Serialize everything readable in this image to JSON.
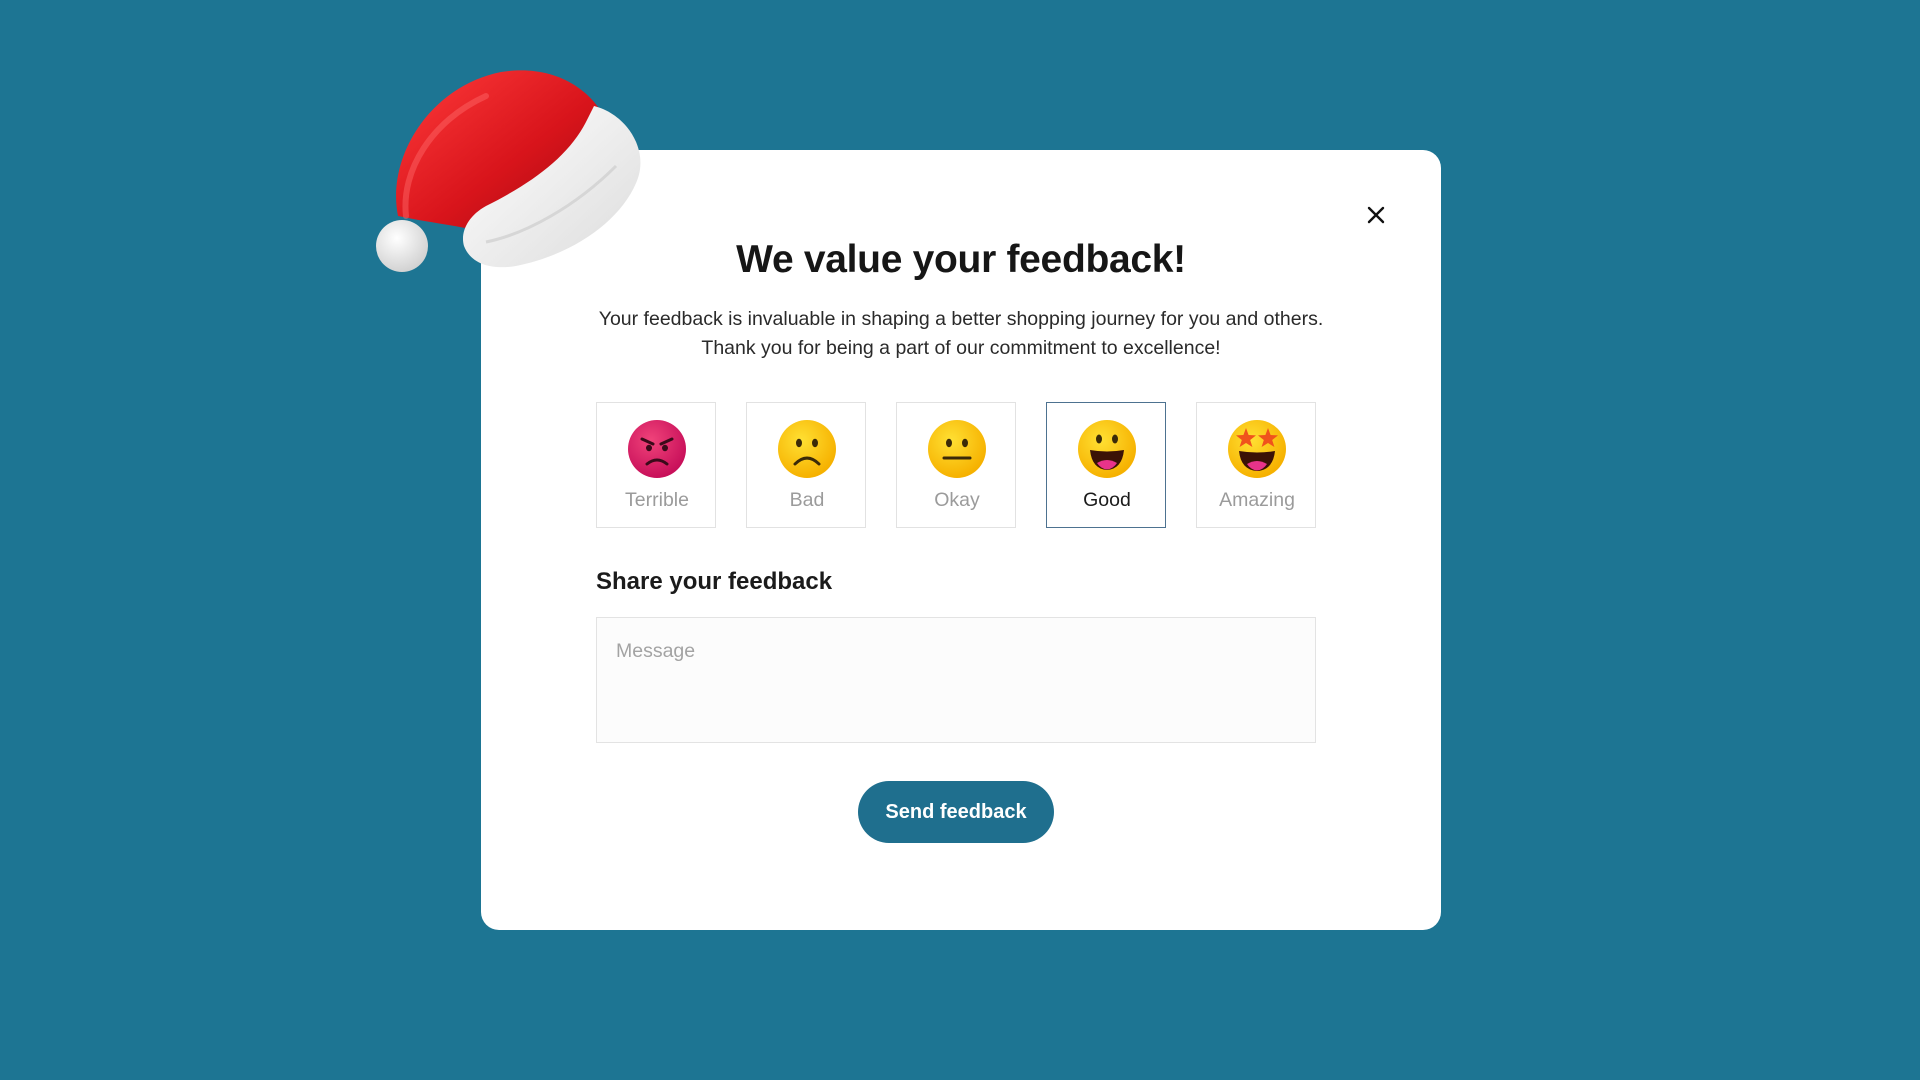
{
  "modal": {
    "title": "We value your feedback!",
    "subtitle": "Your feedback is invaluable in shaping a better shopping journey for you and others. Thank you for being a part of our commitment to excellence!",
    "close_icon": "close-icon"
  },
  "ratings": [
    {
      "label": "Terrible",
      "icon": "angry-face-icon",
      "selected": false
    },
    {
      "label": "Bad",
      "icon": "frowning-face-icon",
      "selected": false
    },
    {
      "label": "Okay",
      "icon": "neutral-face-icon",
      "selected": false
    },
    {
      "label": "Good",
      "icon": "grinning-face-icon",
      "selected": true
    },
    {
      "label": "Amazing",
      "icon": "star-struck-face-icon",
      "selected": false
    }
  ],
  "feedback": {
    "label": "Share your feedback",
    "placeholder": "Message",
    "value": ""
  },
  "submit": {
    "label": "Send feedback"
  },
  "colors": {
    "background": "#1d7593",
    "accent": "#1f6f8e",
    "selected_border": "#4d7290",
    "card": "#ffffff"
  },
  "decoration": {
    "icon": "santa-hat-icon"
  }
}
